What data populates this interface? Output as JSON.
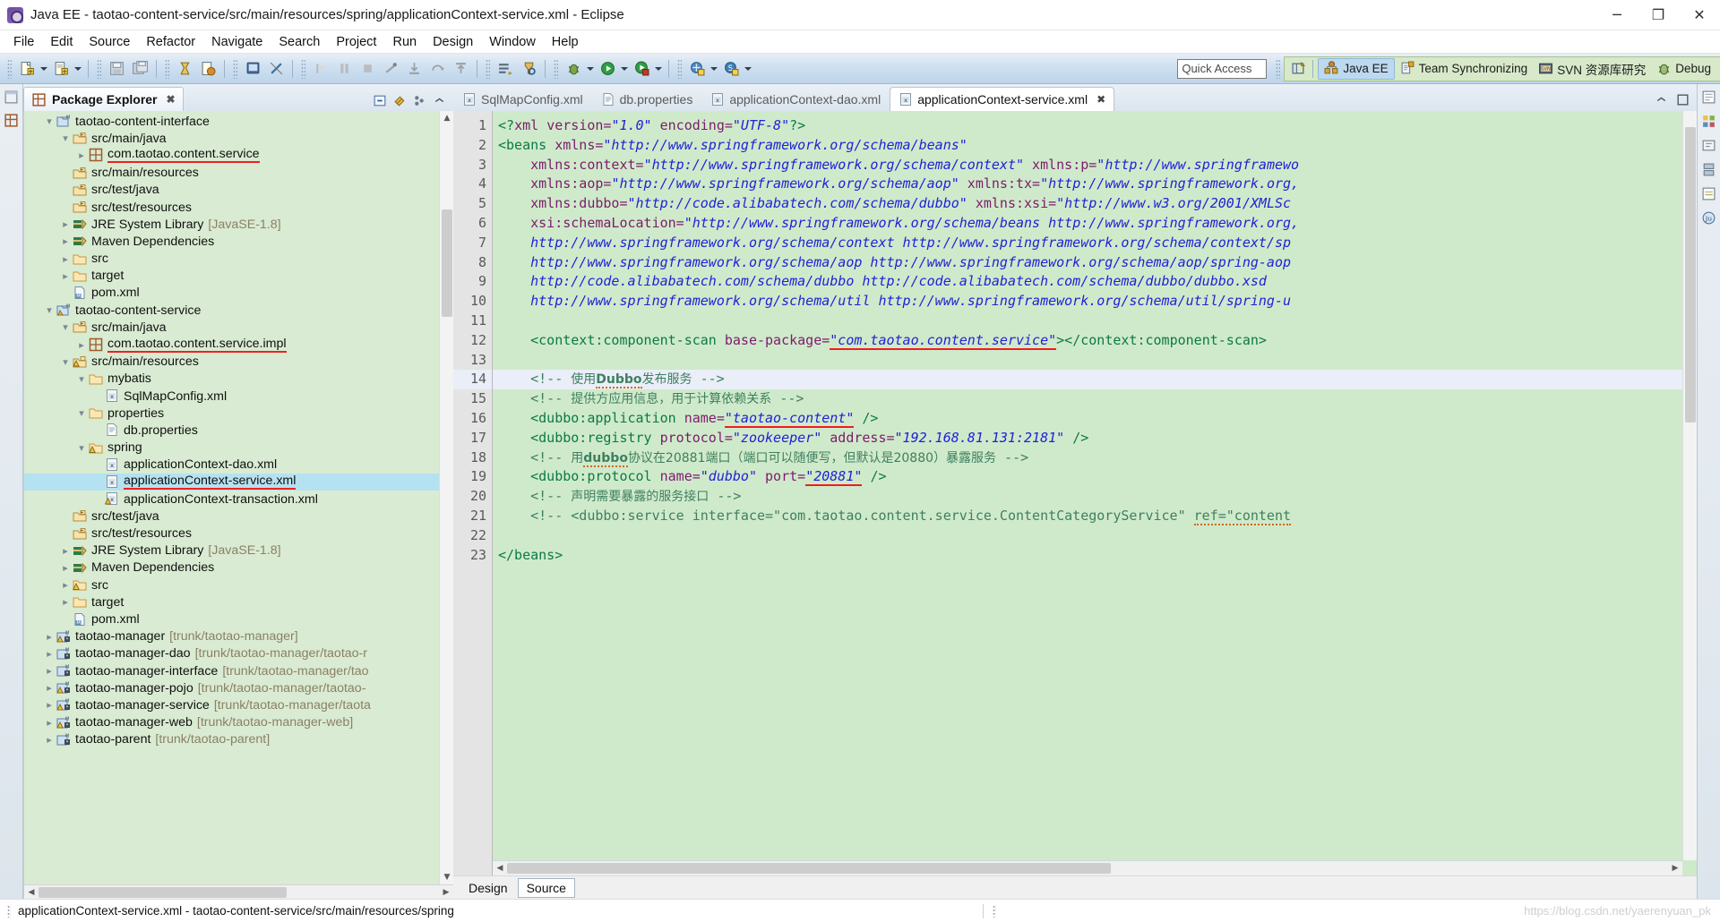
{
  "window": {
    "title": "Java EE - taotao-content-service/src/main/resources/spring/applicationContext-service.xml - Eclipse",
    "minimize": "─",
    "maximize": "❐",
    "close": "✕"
  },
  "menubar": {
    "items": [
      "File",
      "Edit",
      "Source",
      "Refactor",
      "Navigate",
      "Search",
      "Project",
      "Run",
      "Design",
      "Window",
      "Help"
    ]
  },
  "toolbar": {
    "quick_access_placeholder": "Quick Access",
    "groups": [
      [
        "new-wizard-icon",
        "new-dropdown-arrow",
        "new-ee-artifact-icon",
        "ee-dropdown-arrow"
      ],
      [
        "save-icon",
        "save-all-icon"
      ],
      [
        "validate-icon",
        "build-icon"
      ],
      [
        "console-icon",
        "link-break-icon"
      ],
      [
        "resume-icon",
        "suspend-icon",
        "terminate-icon",
        "disconnect-icon",
        "step-into-icon",
        "step-over-icon",
        "step-return-icon"
      ],
      [
        "open-type-icon",
        "search-icon"
      ],
      [
        "debug-icon",
        "debug-dropdown-arrow",
        "run-icon",
        "run-dropdown-arrow",
        "run-server-icon",
        "server-dropdown-arrow"
      ],
      [
        "external-tools-icon",
        "external-dropdown-arrow",
        "new-java-class-icon",
        "class-dropdown-arrow"
      ]
    ]
  },
  "perspective_bar": {
    "open_perspective_icon": "open-perspective-icon",
    "items": [
      {
        "label": "Java EE",
        "icon": "java-ee-perspective-icon",
        "active": true
      },
      {
        "label": "Team Synchronizing",
        "icon": "team-sync-perspective-icon",
        "active": false
      },
      {
        "label": "SVN 资源库研究",
        "icon": "svn-repo-perspective-icon",
        "active": false
      },
      {
        "label": "Debug",
        "icon": "debug-perspective-icon",
        "active": false
      }
    ]
  },
  "explorer": {
    "tab_label": "Package Explorer",
    "tab_close": "✖",
    "tools": [
      "collapse-all-icon",
      "link-with-editor-icon",
      "view-menu-icon",
      "minimize-icon",
      "maximize-icon"
    ],
    "tree": [
      {
        "indent": 1,
        "twisty": "⌄",
        "icon": "maven-project-icon",
        "label": "taotao-content-interface",
        "sub": "",
        "underline": false,
        "selected": false
      },
      {
        "indent": 2,
        "twisty": "⌄",
        "icon": "source-folder-icon",
        "label": "src/main/java",
        "sub": "",
        "underline": false,
        "selected": false
      },
      {
        "indent": 3,
        "twisty": "›",
        "icon": "package-icon",
        "label": "com.taotao.content.service",
        "sub": "",
        "underline": true,
        "selected": false
      },
      {
        "indent": 2,
        "twisty": "",
        "icon": "source-folder-icon",
        "label": "src/main/resources",
        "sub": "",
        "underline": false,
        "selected": false
      },
      {
        "indent": 2,
        "twisty": "",
        "icon": "source-folder-icon",
        "label": "src/test/java",
        "sub": "",
        "underline": false,
        "selected": false
      },
      {
        "indent": 2,
        "twisty": "",
        "icon": "source-folder-icon",
        "label": "src/test/resources",
        "sub": "",
        "underline": false,
        "selected": false
      },
      {
        "indent": 2,
        "twisty": "›",
        "icon": "library-icon",
        "label": "JRE System Library",
        "sub": "[JavaSE-1.8]",
        "underline": false,
        "selected": false
      },
      {
        "indent": 2,
        "twisty": "›",
        "icon": "library-icon",
        "label": "Maven Dependencies",
        "sub": "",
        "underline": false,
        "selected": false
      },
      {
        "indent": 2,
        "twisty": "›",
        "icon": "folder-icon",
        "label": "src",
        "sub": "",
        "underline": false,
        "selected": false
      },
      {
        "indent": 2,
        "twisty": "›",
        "icon": "folder-icon",
        "label": "target",
        "sub": "",
        "underline": false,
        "selected": false
      },
      {
        "indent": 2,
        "twisty": "",
        "icon": "pom-xml-icon",
        "label": "pom.xml",
        "sub": "",
        "underline": false,
        "selected": false
      },
      {
        "indent": 1,
        "twisty": "⌄",
        "icon": "maven-project-warn-icon",
        "label": "taotao-content-service",
        "sub": "",
        "underline": false,
        "selected": false
      },
      {
        "indent": 2,
        "twisty": "⌄",
        "icon": "source-folder-icon",
        "label": "src/main/java",
        "sub": "",
        "underline": false,
        "selected": false
      },
      {
        "indent": 3,
        "twisty": "›",
        "icon": "package-icon",
        "label": "com.taotao.content.service.impl",
        "sub": "",
        "underline": true,
        "selected": false
      },
      {
        "indent": 2,
        "twisty": "⌄",
        "icon": "source-folder-warn-icon",
        "label": "src/main/resources",
        "sub": "",
        "underline": false,
        "selected": false
      },
      {
        "indent": 3,
        "twisty": "⌄",
        "icon": "folder-icon",
        "label": "mybatis",
        "sub": "",
        "underline": false,
        "selected": false
      },
      {
        "indent": 4,
        "twisty": "",
        "icon": "xml-file-icon",
        "label": "SqlMapConfig.xml",
        "sub": "",
        "underline": false,
        "selected": false
      },
      {
        "indent": 3,
        "twisty": "⌄",
        "icon": "folder-icon",
        "label": "properties",
        "sub": "",
        "underline": false,
        "selected": false
      },
      {
        "indent": 4,
        "twisty": "",
        "icon": "properties-file-icon",
        "label": "db.properties",
        "sub": "",
        "underline": false,
        "selected": false
      },
      {
        "indent": 3,
        "twisty": "⌄",
        "icon": "folder-warn-icon",
        "label": "spring",
        "sub": "",
        "underline": false,
        "selected": false
      },
      {
        "indent": 4,
        "twisty": "",
        "icon": "xml-file-icon",
        "label": "applicationContext-dao.xml",
        "sub": "",
        "underline": false,
        "selected": false
      },
      {
        "indent": 4,
        "twisty": "",
        "icon": "xml-file-icon",
        "label": "applicationContext-service.xml",
        "sub": "",
        "underline": true,
        "selected": true
      },
      {
        "indent": 4,
        "twisty": "",
        "icon": "xml-file-warn-icon",
        "label": "applicationContext-transaction.xml",
        "sub": "",
        "underline": false,
        "selected": false
      },
      {
        "indent": 2,
        "twisty": "",
        "icon": "source-folder-icon",
        "label": "src/test/java",
        "sub": "",
        "underline": false,
        "selected": false
      },
      {
        "indent": 2,
        "twisty": "",
        "icon": "source-folder-icon",
        "label": "src/test/resources",
        "sub": "",
        "underline": false,
        "selected": false
      },
      {
        "indent": 2,
        "twisty": "›",
        "icon": "library-icon",
        "label": "JRE System Library",
        "sub": "[JavaSE-1.8]",
        "underline": false,
        "selected": false
      },
      {
        "indent": 2,
        "twisty": "›",
        "icon": "library-icon",
        "label": "Maven Dependencies",
        "sub": "",
        "underline": false,
        "selected": false
      },
      {
        "indent": 2,
        "twisty": "›",
        "icon": "folder-warn-icon",
        "label": "src",
        "sub": "",
        "underline": false,
        "selected": false
      },
      {
        "indent": 2,
        "twisty": "›",
        "icon": "folder-icon",
        "label": "target",
        "sub": "",
        "underline": false,
        "selected": false
      },
      {
        "indent": 2,
        "twisty": "",
        "icon": "pom-xml-icon",
        "label": "pom.xml",
        "sub": "",
        "underline": false,
        "selected": false
      },
      {
        "indent": 1,
        "twisty": "›",
        "icon": "maven-project-svn-warn-icon",
        "label": "taotao-manager",
        "sub": "[trunk/taotao-manager]",
        "underline": false,
        "selected": false
      },
      {
        "indent": 1,
        "twisty": "›",
        "icon": "maven-project-svn-icon",
        "label": "taotao-manager-dao",
        "sub": "[trunk/taotao-manager/taotao-r",
        "underline": false,
        "selected": false
      },
      {
        "indent": 1,
        "twisty": "›",
        "icon": "maven-project-svn-icon",
        "label": "taotao-manager-interface",
        "sub": "[trunk/taotao-manager/tao",
        "underline": false,
        "selected": false
      },
      {
        "indent": 1,
        "twisty": "›",
        "icon": "maven-project-svn-warn-icon",
        "label": "taotao-manager-pojo",
        "sub": "[trunk/taotao-manager/taotao-",
        "underline": false,
        "selected": false
      },
      {
        "indent": 1,
        "twisty": "›",
        "icon": "maven-project-svn-warn-icon",
        "label": "taotao-manager-service",
        "sub": "[trunk/taotao-manager/taota",
        "underline": false,
        "selected": false
      },
      {
        "indent": 1,
        "twisty": "›",
        "icon": "maven-project-svn-warn-icon",
        "label": "taotao-manager-web",
        "sub": "[trunk/taotao-manager-web]",
        "underline": false,
        "selected": false
      },
      {
        "indent": 1,
        "twisty": "›",
        "icon": "maven-project-svn-icon",
        "label": "taotao-parent",
        "sub": "[trunk/taotao-parent]",
        "underline": false,
        "selected": false
      }
    ]
  },
  "editor": {
    "tabs": [
      {
        "label": "SqlMapConfig.xml",
        "icon": "xml-file-icon",
        "active": false
      },
      {
        "label": "db.properties",
        "icon": "properties-file-icon",
        "active": false
      },
      {
        "label": "applicationContext-dao.xml",
        "icon": "xml-file-icon",
        "active": false
      },
      {
        "label": "applicationContext-service.xml",
        "icon": "xml-file-icon",
        "active": true
      }
    ],
    "tab_close": "✖",
    "current_line": 14,
    "bottom_tabs": [
      {
        "label": "Design",
        "active": false
      },
      {
        "label": "Source",
        "active": true
      }
    ],
    "line_numbers": [
      1,
      2,
      3,
      4,
      5,
      6,
      7,
      8,
      9,
      10,
      11,
      12,
      13,
      14,
      15,
      16,
      17,
      18,
      19,
      20,
      21,
      22,
      23
    ],
    "lines": [
      {
        "n": 1,
        "html": "<span class='t-tag'>&lt;?</span><span class='t-pi'>xml</span> <span class='t-attr'>version=</span><span class='t-val'>\"1.0\"</span> <span class='t-attr'>encoding=</span><span class='t-val'>\"UTF-8\"</span><span class='t-tag'>?&gt;</span>"
      },
      {
        "n": 2,
        "html": "<span class='t-tag'>&lt;beans</span> <span class='t-attr'>xmlns=</span><span class='t-val'>\"http://www.springframework.org/schema/beans\"</span>"
      },
      {
        "n": 3,
        "html": "    <span class='t-attr'>xmlns:context=</span><span class='t-val'>\"http://www.springframework.org/schema/context\"</span> <span class='t-attr'>xmlns:p=</span><span class='t-val'>\"http://www.springframewo</span>"
      },
      {
        "n": 4,
        "html": "    <span class='t-attr'>xmlns:aop=</span><span class='t-val'>\"http://www.springframework.org/schema/aop\"</span> <span class='t-attr'>xmlns:tx=</span><span class='t-val'>\"http://www.springframework.org,</span>"
      },
      {
        "n": 5,
        "html": "    <span class='t-attr'>xmlns:dubbo=</span><span class='t-val'>\"http://code.alibabatech.com/schema/dubbo\"</span> <span class='t-attr'>xmlns:xsi=</span><span class='t-val'>\"http://www.w3.org/2001/XMLSc</span>"
      },
      {
        "n": 6,
        "html": "    <span class='t-attr'>xsi:schemaLocation=</span><span class='t-val'>\"http://www.springframework.org/schema/beans http://www.springframework.org,</span>"
      },
      {
        "n": 7,
        "html": "    <span class='t-val'>http://www.springframework.org/schema/context http://www.springframework.org/schema/context/sp</span>"
      },
      {
        "n": 8,
        "html": "    <span class='t-val'>http://www.springframework.org/schema/aop http://www.springframework.org/schema/aop/spring-aop</span>"
      },
      {
        "n": 9,
        "html": "    <span class='t-val'>http://code.alibabatech.com/schema/dubbo http://code.alibabatech.com/schema/dubbo/dubbo.xsd</span>"
      },
      {
        "n": 10,
        "html": "    <span class='t-val'>http://www.springframework.org/schema/util http://www.springframework.org/schema/util/spring-u</span>"
      },
      {
        "n": 11,
        "html": ""
      },
      {
        "n": 12,
        "html": "    <span class='t-tag'>&lt;context:component-scan</span> <span class='t-attr'>base-package=</span><span class='t-val red-u'>\"com.taotao.content.service\"</span><span class='t-tag'>&gt;&lt;/context:component-scan&gt;</span>"
      },
      {
        "n": 13,
        "html": ""
      },
      {
        "n": 14,
        "html": "    <span class='t-cmt'>&lt;!--</span> <span class='t-cmt-cn'>使用</span><span class='t-cmt-cn squiggle'><b>Dubbo</b></span><span class='t-cmt-cn'>发布服务</span> <span class='t-cmt'>--&gt;</span>"
      },
      {
        "n": 15,
        "html": "    <span class='t-cmt'>&lt;!--</span> <span class='t-cmt-cn'>提供方应用信息，用于计算依赖关系</span> <span class='t-cmt'>--&gt;</span>"
      },
      {
        "n": 16,
        "html": "    <span class='t-tag'>&lt;dubbo:application</span> <span class='t-attr'>name=</span><span class='t-val red-u'>\"taotao-content\"</span> <span class='t-tag'>/&gt;</span>"
      },
      {
        "n": 17,
        "html": "    <span class='t-tag'>&lt;dubbo:registry</span> <span class='t-attr'>protocol=</span><span class='t-val'>\"zookeeper\"</span> <span class='t-attr'>address=</span><span class='t-val'>\"192.168.81.131:2181\"</span> <span class='t-tag'>/&gt;</span>"
      },
      {
        "n": 18,
        "html": "    <span class='t-cmt'>&lt;!--</span> <span class='t-cmt-cn'>用</span><span class='t-cmt-cn squiggle'><b>dubbo</b></span><span class='t-cmt-cn'>协议在20881端口（端口可以随便写，但默认是20880）暴露服务</span> <span class='t-cmt'>--&gt;</span>"
      },
      {
        "n": 19,
        "html": "    <span class='t-tag'>&lt;dubbo:protocol</span> <span class='t-attr'>name=</span><span class='t-val'>\"dubbo\"</span> <span class='t-attr'>port=</span><span class='t-val red-u'>\"20881\"</span> <span class='t-tag'>/&gt;</span>"
      },
      {
        "n": 20,
        "html": "    <span class='t-cmt'>&lt;!--</span> <span class='t-cmt-cn'>声明需要暴露的服务接口</span> <span class='t-cmt'>--&gt;</span>"
      },
      {
        "n": 21,
        "html": "    <span class='t-cmt'>&lt;!-- &lt;dubbo:service interface=\"com.taotao.content.service.ContentCategoryService\"</span> <span class='squiggle' style='color:#3f7f5f'>ref=\"content</span>"
      },
      {
        "n": 22,
        "html": ""
      },
      {
        "n": 23,
        "html": "<span class='t-tag'>&lt;/beans&gt;</span>"
      }
    ]
  },
  "statusbar": {
    "text": "applicationContext-service.xml - taotao-content-service/src/main/resources/spring",
    "watermark": "https://blog.csdn.net/yaerenyuan_pk"
  }
}
